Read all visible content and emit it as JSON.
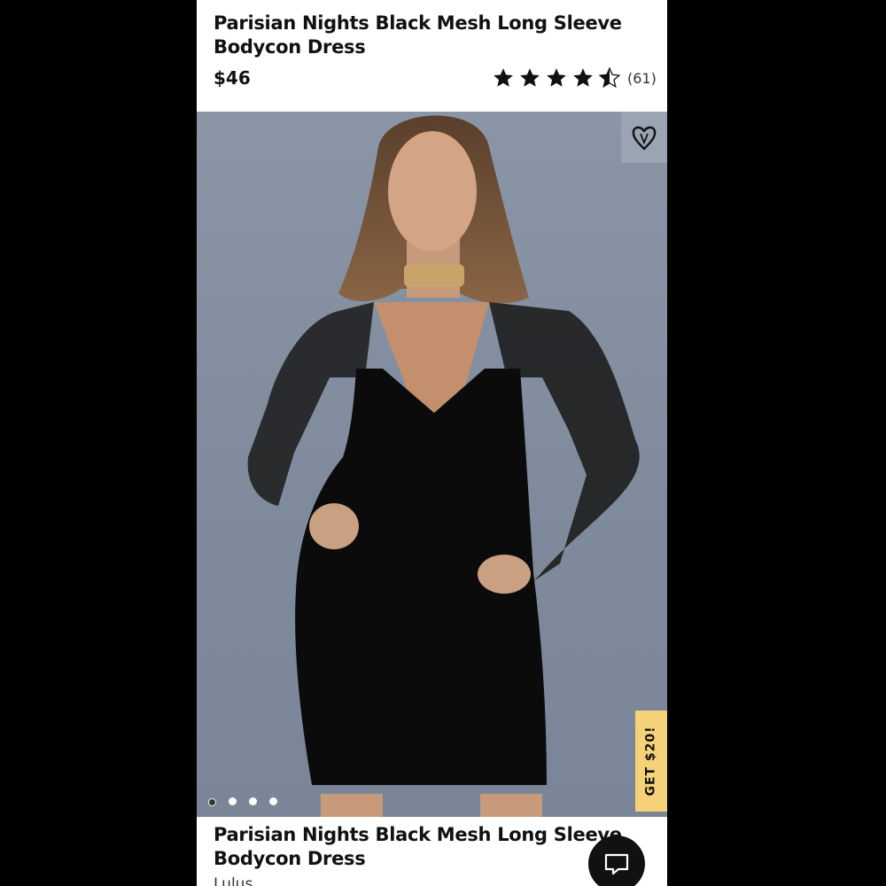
{
  "product": {
    "title": "Parisian Nights Black Mesh Long Sleeve Bodycon Dress",
    "price": "$46",
    "rating": 4.5,
    "review_count": "(61)"
  },
  "promo": {
    "label": "GET $20!",
    "color": "#f5d27a"
  },
  "gallery": {
    "slides": 4,
    "active": 1
  },
  "details": {
    "title": "Parisian Nights Black Mesh Long Sleeve Bodycon Dress",
    "brand": "Lulus"
  },
  "icons": {
    "favorite": "heart-outline-icon",
    "chat": "chat-bubble-icon",
    "star": "star-icon"
  }
}
